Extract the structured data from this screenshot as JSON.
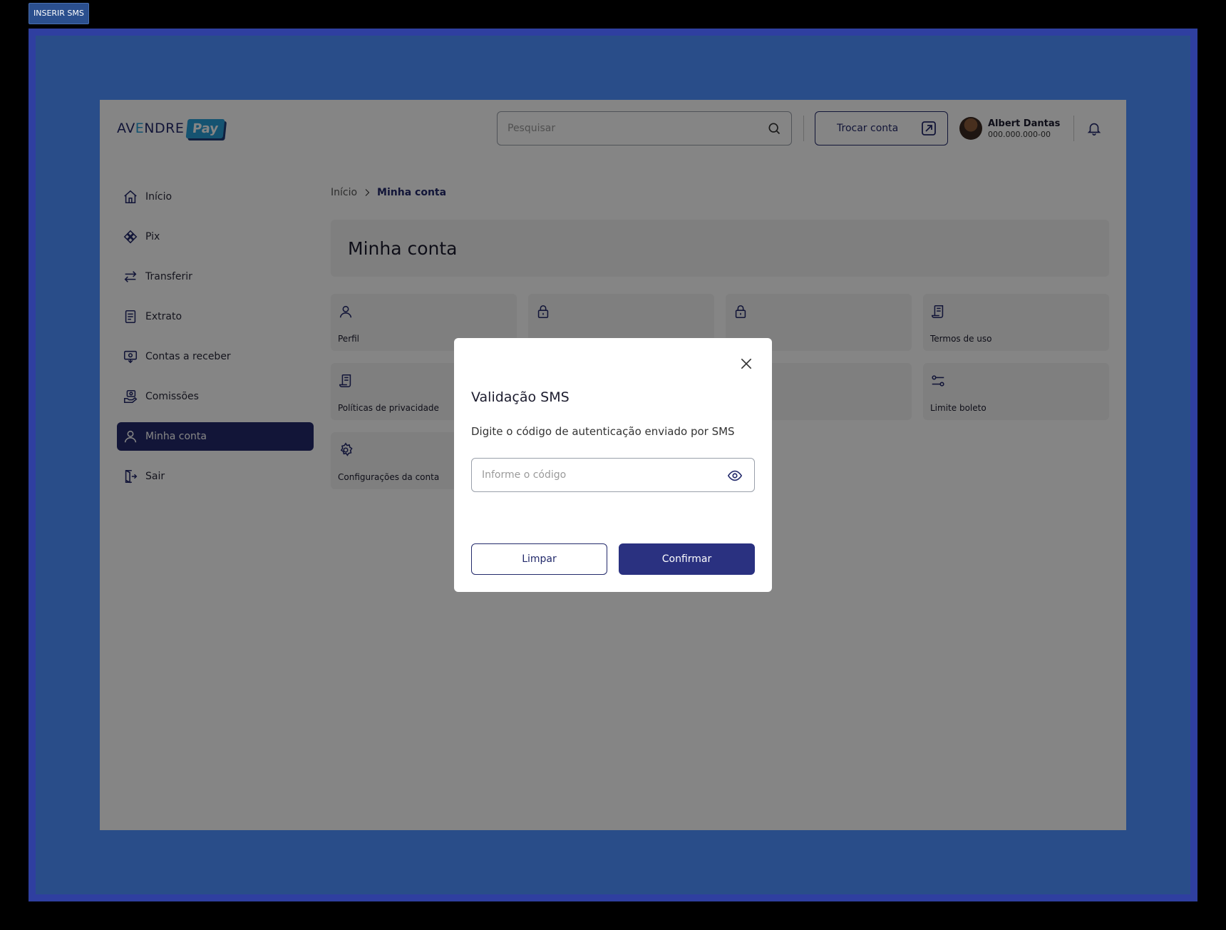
{
  "frame": {
    "tag": "INSERIR SMS"
  },
  "header": {
    "logo_prefix": "AV",
    "logo_e": "E",
    "logo_suffix": "NDRE",
    "logo_pay": "Pay",
    "search_placeholder": "Pesquisar",
    "switch_account": "Trocar conta",
    "user_name": "Albert Dantas",
    "user_document": "000.000.000-00"
  },
  "sidebar": {
    "items": [
      {
        "label": "Início",
        "icon": "home-icon"
      },
      {
        "label": "Pix",
        "icon": "pix-icon"
      },
      {
        "label": "Transferir",
        "icon": "transfer-icon"
      },
      {
        "label": "Extrato",
        "icon": "statement-icon"
      },
      {
        "label": "Contas a receber",
        "icon": "receivables-icon"
      },
      {
        "label": "Comissões",
        "icon": "commission-icon"
      },
      {
        "label": "Minha conta",
        "icon": "user-icon",
        "active": true
      },
      {
        "label": "Sair",
        "icon": "logout-icon"
      }
    ]
  },
  "breadcrumb": {
    "home": "Início",
    "current": "Minha conta"
  },
  "page": {
    "title": "Minha conta"
  },
  "cards": [
    {
      "label": "Perfil",
      "icon": "user-icon"
    },
    {
      "label": "",
      "icon": "lock-icon"
    },
    {
      "label": "",
      "icon": "lock-icon"
    },
    {
      "label": "Termos de uso",
      "icon": "scroll-icon"
    },
    {
      "label": "Políticas de privacidade",
      "icon": "scroll-icon"
    },
    {
      "label": "",
      "icon": "lock-icon"
    },
    {
      "label": "",
      "icon": "lock-icon"
    },
    {
      "label": "Limite boleto",
      "icon": "sliders-icon"
    },
    {
      "label": "Configurações da conta",
      "icon": "gear-icon"
    }
  ],
  "modal": {
    "title": "Validação SMS",
    "description": "Digite o código de autenticação enviado por SMS",
    "code_placeholder": "Informe o código",
    "clear_label": "Limpar",
    "confirm_label": "Confirmar"
  },
  "colors": {
    "primary": "#232a6b",
    "confirm": "#2a3180",
    "accent": "#2aa0d8",
    "frame": "#294d89"
  }
}
